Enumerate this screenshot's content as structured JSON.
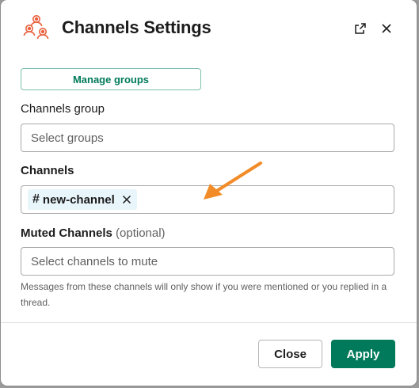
{
  "modal": {
    "title": "Channels Settings",
    "app_icon": "people-group-icon",
    "open_icon": "external-link-icon",
    "close_icon": "close-icon"
  },
  "manage_groups": {
    "label": "Manage groups"
  },
  "channels_group": {
    "label": "Channels group",
    "placeholder": "Select groups"
  },
  "channels": {
    "label": "Channels",
    "selected": [
      {
        "name": "new-channel",
        "hash": "#"
      }
    ],
    "remove_icon": "close-icon"
  },
  "muted_channels": {
    "label": "Muted Channels",
    "optional": "(optional)",
    "placeholder": "Select channels to mute",
    "help": "Messages from these channels will only show if you were mentioned or you replied in a thread."
  },
  "footer": {
    "close_label": "Close",
    "apply_label": "Apply"
  },
  "colors": {
    "accent": "#007a5a",
    "annotation_arrow": "#f28c28",
    "icon_orange": "#e8603c"
  }
}
